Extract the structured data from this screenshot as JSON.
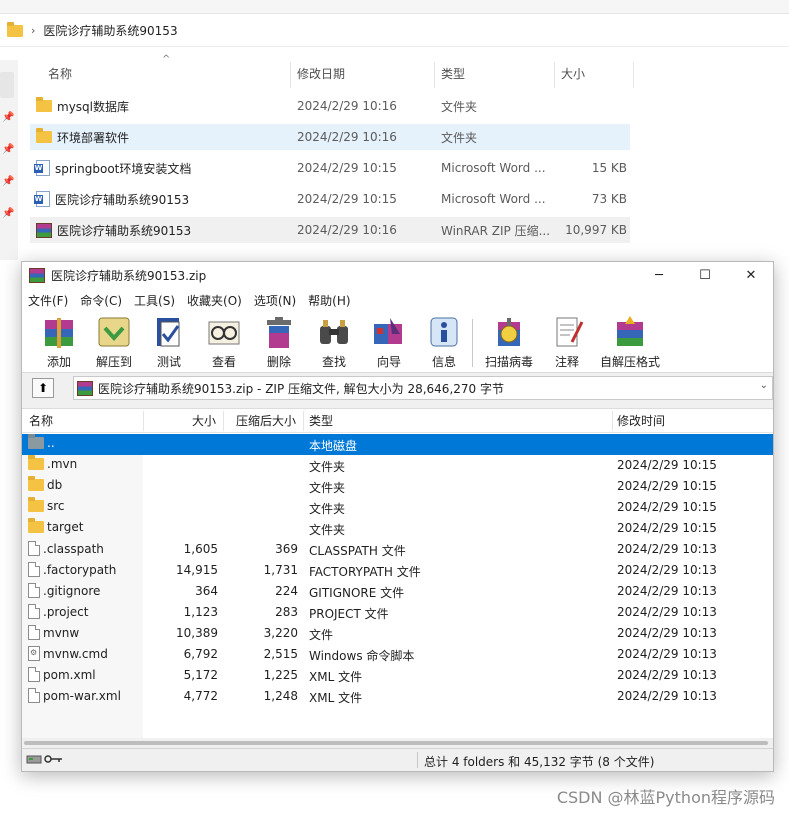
{
  "explorer": {
    "breadcrumb": "医院诊疗辅助系统90153",
    "columns": {
      "name": "名称",
      "date": "修改日期",
      "type": "类型",
      "size": "大小"
    },
    "rows": [
      {
        "icon": "folder-icon",
        "name": "mysql数据库",
        "date": "2024/2/29 10:16",
        "type": "文件夹",
        "size": ""
      },
      {
        "icon": "folder-icon",
        "name": "环境部署软件",
        "date": "2024/2/29 10:16",
        "type": "文件夹",
        "size": ""
      },
      {
        "icon": "word-doc-icon",
        "name": "springboot环境安装文档",
        "date": "2024/2/29 10:15",
        "type": "Microsoft Word ...",
        "size": "15 KB"
      },
      {
        "icon": "word-doc-icon",
        "name": "医院诊疗辅助系统90153",
        "date": "2024/2/29 10:15",
        "type": "Microsoft Word ...",
        "size": "73 KB"
      },
      {
        "icon": "winrar-archive-icon",
        "name": "医院诊疗辅助系统90153",
        "date": "2024/2/29 10:16",
        "type": "WinRAR ZIP 压缩...",
        "size": "10,997 KB"
      }
    ]
  },
  "winrar": {
    "title": "医院诊疗辅助系统90153.zip",
    "menu": [
      "文件(F)",
      "命令(C)",
      "工具(S)",
      "收藏夹(O)",
      "选项(N)",
      "帮助(H)"
    ],
    "toolbar": [
      {
        "icon": "add-icon",
        "label": "添加"
      },
      {
        "icon": "extract-to-icon",
        "label": "解压到"
      },
      {
        "icon": "test-icon",
        "label": "测试"
      },
      {
        "icon": "view-icon",
        "label": "查看"
      },
      {
        "icon": "delete-icon",
        "label": "删除"
      },
      {
        "icon": "find-icon",
        "label": "查找"
      },
      {
        "icon": "wizard-icon",
        "label": "向导"
      },
      {
        "icon": "info-icon",
        "label": "信息"
      },
      {
        "icon": "virus-scan-icon",
        "label": "扫描病毒"
      },
      {
        "icon": "comment-icon",
        "label": "注释"
      },
      {
        "icon": "sfx-icon",
        "label": "自解压格式"
      }
    ],
    "path": "医院诊疗辅助系统90153.zip - ZIP 压缩文件, 解包大小为 28,646,270 字节",
    "columns": {
      "name": "名称",
      "size": "大小",
      "packed": "压缩后大小",
      "type": "类型",
      "modified": "修改时间"
    },
    "rows": [
      {
        "icon": "up-folder-icon",
        "name": "..",
        "size": "",
        "packed": "",
        "type": "本地磁盘",
        "modified": ""
      },
      {
        "icon": "folder-icon",
        "name": ".mvn",
        "size": "",
        "packed": "",
        "type": "文件夹",
        "modified": "2024/2/29 10:15"
      },
      {
        "icon": "folder-icon",
        "name": "db",
        "size": "",
        "packed": "",
        "type": "文件夹",
        "modified": "2024/2/29 10:15"
      },
      {
        "icon": "folder-icon",
        "name": "src",
        "size": "",
        "packed": "",
        "type": "文件夹",
        "modified": "2024/2/29 10:15"
      },
      {
        "icon": "folder-icon",
        "name": "target",
        "size": "",
        "packed": "",
        "type": "文件夹",
        "modified": "2024/2/29 10:15"
      },
      {
        "icon": "file-icon",
        "name": ".classpath",
        "size": "1,605",
        "packed": "369",
        "type": "CLASSPATH 文件",
        "modified": "2024/2/29 10:13"
      },
      {
        "icon": "file-icon",
        "name": ".factorypath",
        "size": "14,915",
        "packed": "1,731",
        "type": "FACTORYPATH 文件",
        "modified": "2024/2/29 10:13"
      },
      {
        "icon": "file-icon",
        "name": ".gitignore",
        "size": "364",
        "packed": "224",
        "type": "GITIGNORE 文件",
        "modified": "2024/2/29 10:13"
      },
      {
        "icon": "file-icon",
        "name": ".project",
        "size": "1,123",
        "packed": "283",
        "type": "PROJECT 文件",
        "modified": "2024/2/29 10:13"
      },
      {
        "icon": "file-icon",
        "name": "mvnw",
        "size": "10,389",
        "packed": "3,220",
        "type": "文件",
        "modified": "2024/2/29 10:13"
      },
      {
        "icon": "cmd-script-icon",
        "name": "mvnw.cmd",
        "size": "6,792",
        "packed": "2,515",
        "type": "Windows 命令脚本",
        "modified": "2024/2/29 10:13"
      },
      {
        "icon": "file-icon",
        "name": "pom.xml",
        "size": "5,172",
        "packed": "1,225",
        "type": "XML 文件",
        "modified": "2024/2/29 10:13"
      },
      {
        "icon": "file-icon",
        "name": "pom-war.xml",
        "size": "4,772",
        "packed": "1,248",
        "type": "XML 文件",
        "modified": "2024/2/29 10:13"
      }
    ],
    "status": "总计 4 folders 和 45,132 字节 (8 个文件)"
  },
  "watermark": "CSDN @林蓝Python程序源码"
}
